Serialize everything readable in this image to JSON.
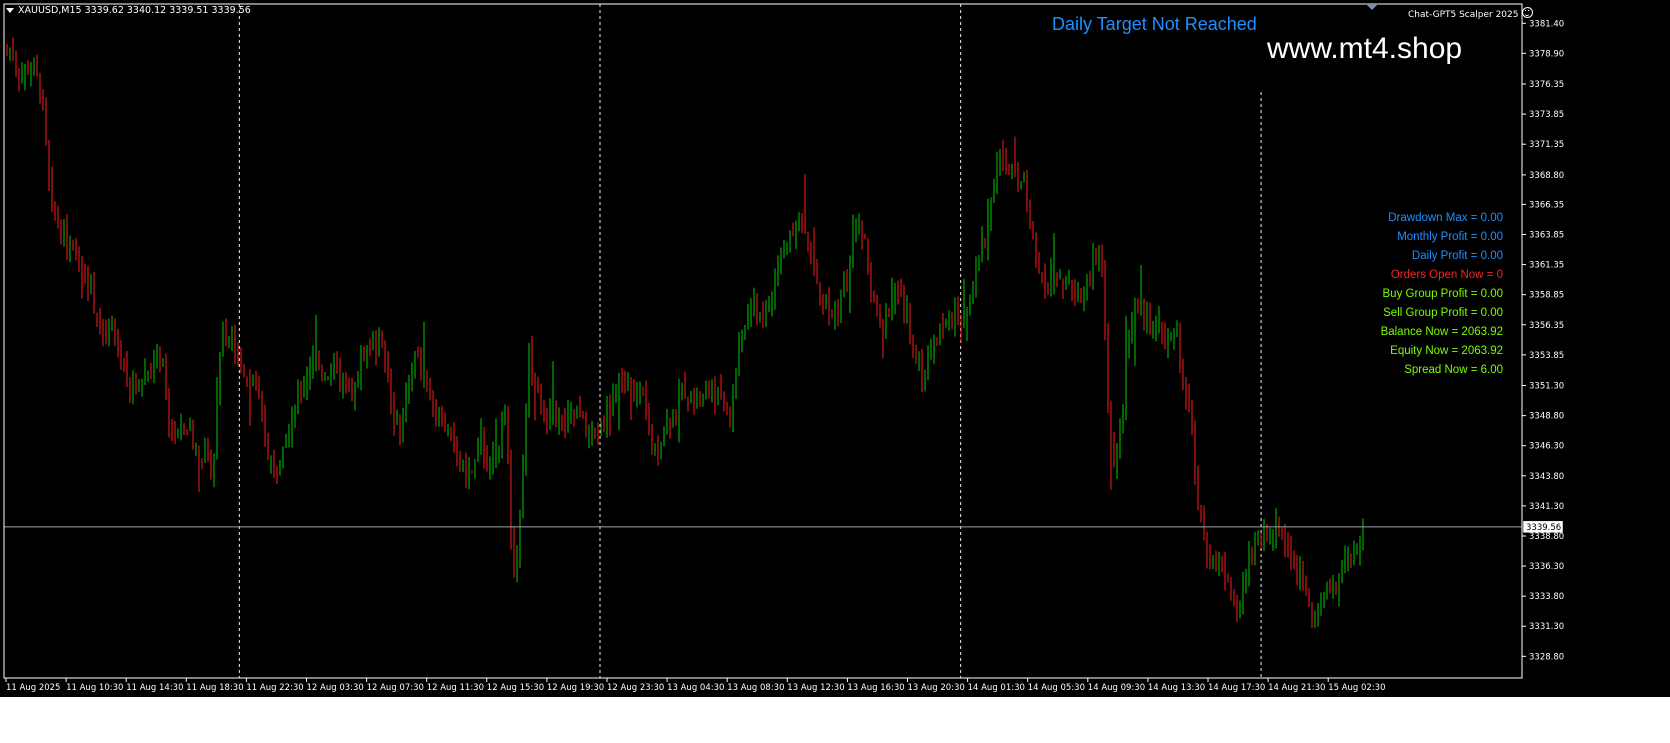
{
  "header": {
    "symbol_menu_icon": "triangle-down-icon",
    "symbol_line": "XAUUSD,M15  3339.62 3340.12 3339.51 3339.56"
  },
  "ea": {
    "name": "Chat-GPT5 Scalper 2025",
    "icon": "smiley-icon"
  },
  "daily_target": {
    "text": "Daily Target Not Reached",
    "color": "#1e90ff"
  },
  "watermark": "www.mt4.shop",
  "stats": [
    {
      "text": "Drawdown Max = 0.00",
      "color": "#1e90ff"
    },
    {
      "text": "Monthly Profit = 0.00",
      "color": "#1e90ff"
    },
    {
      "text": "Daily Profit = 0.00",
      "color": "#1e90ff"
    },
    {
      "text": "Orders Open Now = 0",
      "color": "#ff2020"
    },
    {
      "text": "Buy Group Profit = 0.00",
      "color": "#7cfc00"
    },
    {
      "text": "Sell Group Profit = 0.00",
      "color": "#7cfc00"
    },
    {
      "text": "Balance Now = 2063.92",
      "color": "#7cfc00"
    },
    {
      "text": "Equity Now = 2063.92",
      "color": "#7cfc00"
    },
    {
      "text": "Spread Now = 6.00",
      "color": "#7cfc00"
    }
  ],
  "colors": {
    "background": "#000000",
    "bull": "#00c800",
    "bear": "#ff1a1a",
    "grid_separator": "#c8c8c8",
    "bid_line": "#9aa4b0",
    "axis_text": "#ffffff"
  },
  "chart_data": {
    "type": "candlestick",
    "symbol": "XAUUSD",
    "timeframe": "M15",
    "ylim": [
      3327.0,
      3383.0
    ],
    "y_ticks": [
      "3381.40",
      "3378.90",
      "3376.35",
      "3373.85",
      "3371.35",
      "3368.80",
      "3366.35",
      "3363.85",
      "3361.35",
      "3358.85",
      "3356.35",
      "3353.85",
      "3351.30",
      "3348.80",
      "3346.30",
      "3343.80",
      "3341.30",
      "3338.80",
      "3336.30",
      "3333.80",
      "3331.30",
      "3328.80"
    ],
    "x_ticks": [
      "11 Aug 2025",
      "11 Aug 10:30",
      "11 Aug 14:30",
      "11 Aug 18:30",
      "11 Aug 22:30",
      "12 Aug 03:30",
      "12 Aug 07:30",
      "12 Aug 11:30",
      "12 Aug 15:30",
      "12 Aug 19:30",
      "12 Aug 23:30",
      "13 Aug 04:30",
      "13 Aug 08:30",
      "13 Aug 12:30",
      "13 Aug 16:30",
      "13 Aug 20:30",
      "14 Aug 01:30",
      "14 Aug 05:30",
      "14 Aug 09:30",
      "14 Aug 13:30",
      "14 Aug 17:30",
      "14 Aug 21:30",
      "15 Aug 02:30"
    ],
    "current_price": "3339.56",
    "last_bar": {
      "open": 3339.62,
      "high": 3340.12,
      "low": 3339.51,
      "close": 3339.56
    },
    "day_separators_before": [
      "11 Aug 22:30",
      "12 Aug 23:30",
      "14 Aug 01:30",
      "14 Aug 21:30"
    ],
    "price_path": [
      [
        0,
        3377.5
      ],
      [
        8,
        3379.5
      ],
      [
        20,
        3377
      ],
      [
        30,
        3378
      ],
      [
        40,
        3376
      ],
      [
        50,
        3366
      ],
      [
        62,
        3364
      ],
      [
        72,
        3362
      ],
      [
        84,
        3361
      ],
      [
        96,
        3357
      ],
      [
        102,
        3355
      ],
      [
        112,
        3356
      ],
      [
        122,
        3353
      ],
      [
        130,
        3351
      ],
      [
        140,
        3352
      ],
      [
        150,
        3353
      ],
      [
        160,
        3354
      ],
      [
        168,
        3348
      ],
      [
        176,
        3347
      ],
      [
        186,
        3348
      ],
      [
        196,
        3346
      ],
      [
        206,
        3345
      ],
      [
        212,
        3344
      ],
      [
        220,
        3356
      ],
      [
        230,
        3355
      ],
      [
        240,
        3353
      ],
      [
        250,
        3352
      ],
      [
        258,
        3350
      ],
      [
        266,
        3346
      ],
      [
        274,
        3344
      ],
      [
        282,
        3347
      ],
      [
        292,
        3349
      ],
      [
        302,
        3351
      ],
      [
        312,
        3354
      ],
      [
        322,
        3352
      ],
      [
        332,
        3353
      ],
      [
        342,
        3351
      ],
      [
        352,
        3350
      ],
      [
        362,
        3354
      ],
      [
        372,
        3355
      ],
      [
        382,
        3355
      ],
      [
        390,
        3350
      ],
      [
        398,
        3347
      ],
      [
        406,
        3351
      ],
      [
        414,
        3354
      ],
      [
        424,
        3352
      ],
      [
        434,
        3349
      ],
      [
        444,
        3348
      ],
      [
        454,
        3346
      ],
      [
        464,
        3344
      ],
      [
        472,
        3344
      ],
      [
        480,
        3347
      ],
      [
        488,
        3344
      ],
      [
        496,
        3346
      ],
      [
        504,
        3350
      ],
      [
        510,
        3339
      ],
      [
        514,
        3335
      ],
      [
        520,
        3341
      ],
      [
        528,
        3354
      ],
      [
        534,
        3351
      ],
      [
        542,
        3349
      ],
      [
        552,
        3349
      ],
      [
        562,
        3348
      ],
      [
        572,
        3349
      ],
      [
        582,
        3348
      ],
      [
        592,
        3347
      ],
      [
        602,
        3348
      ],
      [
        612,
        3351
      ],
      [
        622,
        3352
      ],
      [
        632,
        3351
      ],
      [
        642,
        3350
      ],
      [
        650,
        3346
      ],
      [
        656,
        3346
      ],
      [
        662,
        3348
      ],
      [
        672,
        3349
      ],
      [
        682,
        3351
      ],
      [
        692,
        3350
      ],
      [
        702,
        3351
      ],
      [
        712,
        3351
      ],
      [
        722,
        3350
      ],
      [
        728,
        3348
      ],
      [
        734,
        3352
      ],
      [
        742,
        3356
      ],
      [
        752,
        3358
      ],
      [
        762,
        3357
      ],
      [
        772,
        3359
      ],
      [
        780,
        3362
      ],
      [
        788,
        3364
      ],
      [
        796,
        3365
      ],
      [
        804,
        3364
      ],
      [
        812,
        3361
      ],
      [
        820,
        3359
      ],
      [
        830,
        3357
      ],
      [
        838,
        3358
      ],
      [
        848,
        3361
      ],
      [
        856,
        3365
      ],
      [
        864,
        3363
      ],
      [
        872,
        3358
      ],
      [
        880,
        3356
      ],
      [
        888,
        3358
      ],
      [
        896,
        3359
      ],
      [
        906,
        3357
      ],
      [
        914,
        3354
      ],
      [
        922,
        3352
      ],
      [
        930,
        3354
      ],
      [
        938,
        3356
      ],
      [
        946,
        3357
      ],
      [
        954,
        3357
      ],
      [
        962,
        3357
      ],
      [
        970,
        3359
      ],
      [
        978,
        3362
      ],
      [
        986,
        3364
      ],
      [
        992,
        3368
      ],
      [
        998,
        3371
      ],
      [
        1006,
        3369
      ],
      [
        1014,
        3369
      ],
      [
        1022,
        3368
      ],
      [
        1030,
        3365
      ],
      [
        1038,
        3360
      ],
      [
        1046,
        3360
      ],
      [
        1054,
        3361
      ],
      [
        1062,
        3360
      ],
      [
        1072,
        3359
      ],
      [
        1082,
        3359
      ],
      [
        1090,
        3361
      ],
      [
        1096,
        3362
      ],
      [
        1100,
        3362
      ],
      [
        1104,
        3356
      ],
      [
        1108,
        3348
      ],
      [
        1114,
        3344
      ],
      [
        1120,
        3348
      ],
      [
        1126,
        3355
      ],
      [
        1134,
        3358
      ],
      [
        1142,
        3357
      ],
      [
        1150,
        3356
      ],
      [
        1158,
        3356
      ],
      [
        1166,
        3355
      ],
      [
        1174,
        3356
      ],
      [
        1182,
        3352
      ],
      [
        1190,
        3348
      ],
      [
        1196,
        3342
      ],
      [
        1202,
        3340
      ],
      [
        1208,
        3337
      ],
      [
        1214,
        3337
      ],
      [
        1222,
        3336
      ],
      [
        1230,
        3334
      ],
      [
        1238,
        3333
      ],
      [
        1246,
        3336
      ],
      [
        1254,
        3338
      ],
      [
        1262,
        3339
      ],
      [
        1270,
        3339
      ],
      [
        1278,
        3340
      ],
      [
        1286,
        3338
      ],
      [
        1294,
        3336
      ],
      [
        1302,
        3335
      ],
      [
        1310,
        3333
      ],
      [
        1318,
        3333
      ],
      [
        1326,
        3334
      ],
      [
        1334,
        3335
      ],
      [
        1342,
        3336
      ],
      [
        1350,
        3337
      ],
      [
        1356,
        3337
      ],
      [
        1362,
        3339.56
      ]
    ]
  }
}
